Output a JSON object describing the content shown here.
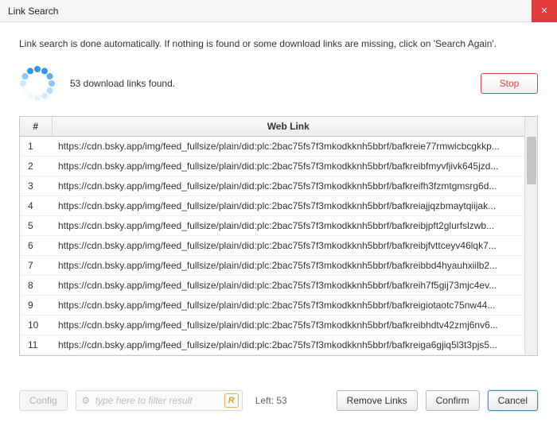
{
  "window": {
    "title": "Link Search"
  },
  "info_text": "Link search is done automatically. If nothing is found or some download links are missing, click on 'Search Again'.",
  "status_text": "53 download links found.",
  "stop_label": "Stop",
  "table": {
    "col_num": "#",
    "col_link": "Web Link"
  },
  "rows": [
    {
      "n": "1",
      "url": "https://cdn.bsky.app/img/feed_fullsize/plain/did:plc:2bac75fs7f3mkodkknh5bbrf/bafkreie77rmwicbcgkkp..."
    },
    {
      "n": "2",
      "url": "https://cdn.bsky.app/img/feed_fullsize/plain/did:plc:2bac75fs7f3mkodkknh5bbrf/bafkreibfmyvfjivk645jzd..."
    },
    {
      "n": "3",
      "url": "https://cdn.bsky.app/img/feed_fullsize/plain/did:plc:2bac75fs7f3mkodkknh5bbrf/bafkreifh3fzmtgmsrg6d..."
    },
    {
      "n": "4",
      "url": "https://cdn.bsky.app/img/feed_fullsize/plain/did:plc:2bac75fs7f3mkodkknh5bbrf/bafkreiajjqzbmaytqiijak..."
    },
    {
      "n": "5",
      "url": "https://cdn.bsky.app/img/feed_fullsize/plain/did:plc:2bac75fs7f3mkodkknh5bbrf/bafkreibjpft2glurfslzwb..."
    },
    {
      "n": "6",
      "url": "https://cdn.bsky.app/img/feed_fullsize/plain/did:plc:2bac75fs7f3mkodkknh5bbrf/bafkreibjfvttceyv46lqk7..."
    },
    {
      "n": "7",
      "url": "https://cdn.bsky.app/img/feed_fullsize/plain/did:plc:2bac75fs7f3mkodkknh5bbrf/bafkreibbd4hyauhxiilb2..."
    },
    {
      "n": "8",
      "url": "https://cdn.bsky.app/img/feed_fullsize/plain/did:plc:2bac75fs7f3mkodkknh5bbrf/bafkreih7f5gij73mjc4ev..."
    },
    {
      "n": "9",
      "url": "https://cdn.bsky.app/img/feed_fullsize/plain/did:plc:2bac75fs7f3mkodkknh5bbrf/bafkreigiotaotc75nw44..."
    },
    {
      "n": "10",
      "url": "https://cdn.bsky.app/img/feed_fullsize/plain/did:plc:2bac75fs7f3mkodkknh5bbrf/bafkreibhdtv42zmj6nv6..."
    },
    {
      "n": "11",
      "url": "https://cdn.bsky.app/img/feed_fullsize/plain/did:plc:2bac75fs7f3mkodkknh5bbrf/bafkreiga6gjiq5l3t3pjs5..."
    }
  ],
  "filter": {
    "placeholder": "type here to filter result",
    "regex_btn": "R"
  },
  "left_text": "Left: 53",
  "buttons": {
    "config": "Config",
    "remove": "Remove Links",
    "confirm": "Confirm",
    "cancel": "Cancel"
  },
  "spinner_colors": [
    "#3196e8",
    "#3196e8",
    "#5ab0ee",
    "#8cc9f4",
    "#b6ddf8",
    "#d3ebfb",
    "#e5f3fd",
    "#f0f8fe",
    "#f6fbfe",
    "#cfe9fb",
    "#8cc9f4",
    "#3196e8"
  ]
}
